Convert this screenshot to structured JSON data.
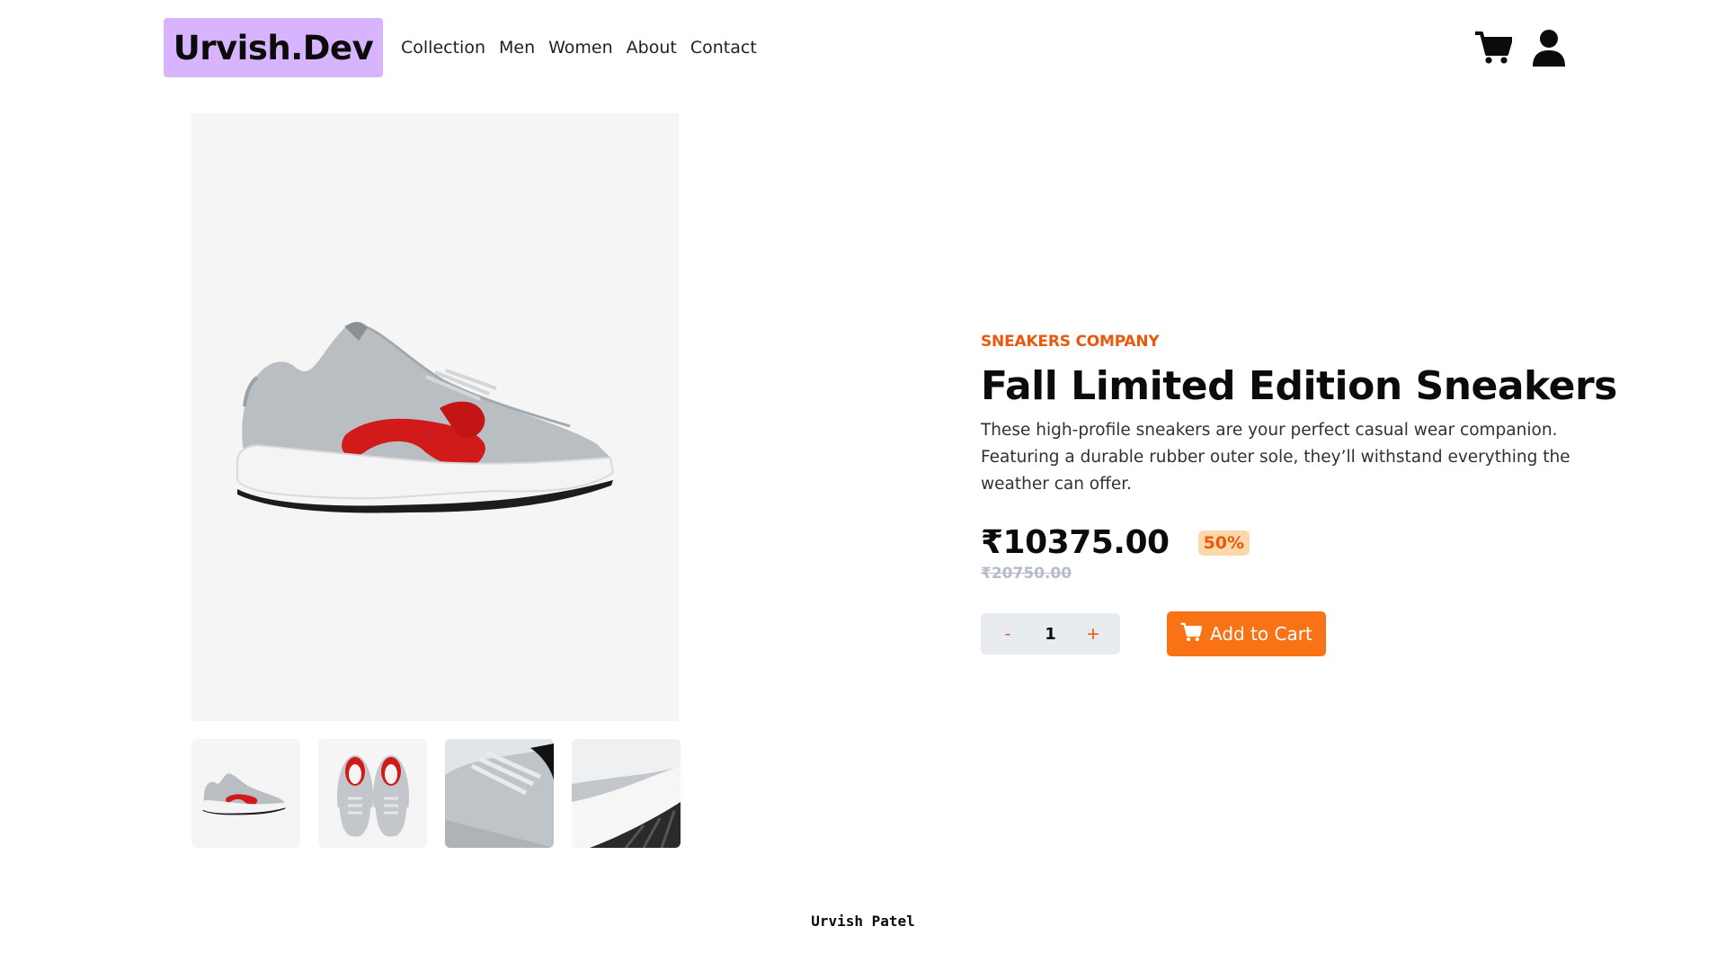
{
  "header": {
    "logo": "Urvish.Dev",
    "nav": [
      "Collection",
      "Men",
      "Women",
      "About",
      "Contact"
    ],
    "icons": [
      "cart-icon",
      "user-icon"
    ]
  },
  "gallery": {
    "main_image": "sneaker-side-view",
    "thumbnails": [
      "sneaker-side-view",
      "sneaker-top-view",
      "sneaker-closeup-laces",
      "sneaker-closeup-sole"
    ]
  },
  "product": {
    "company": "SNEAKERS COMPANY",
    "title": "Fall Limited Edition Sneakers",
    "description": "These high-profile sneakers are your perfect casual wear companion. Featuring a durable rubber outer sole, they’ll withstand everything the weather can offer.",
    "price": "₹10375.00",
    "discount": "50%",
    "original_price": "₹20750.00",
    "quantity": {
      "minus": "-",
      "value": "1",
      "plus": "+"
    },
    "add_to_cart": "Add to Cart"
  },
  "footer": {
    "author": "Urvish Patel"
  },
  "colors": {
    "accent": "#f97316",
    "accent_dark": "#ea580c",
    "logo_bg": "#d8b4fe",
    "badge_bg": "#fed7aa"
  }
}
